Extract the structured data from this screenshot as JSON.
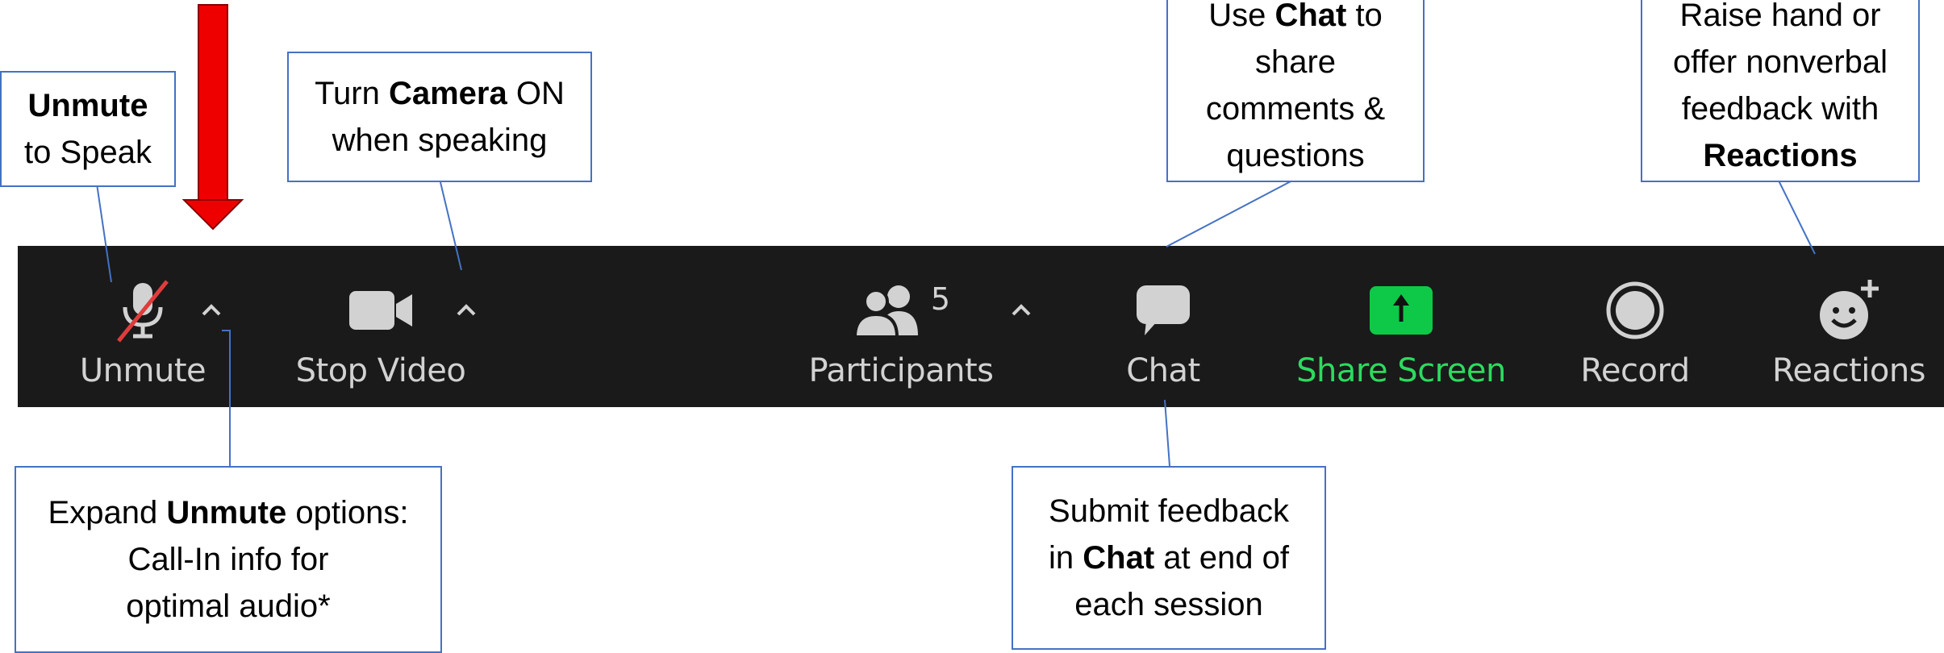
{
  "toolbar": {
    "unmute_label": "Unmute",
    "stop_video_label": "Stop Video",
    "participants_label": "Participants",
    "participants_count": "5",
    "chat_label": "Chat",
    "share_screen_label": "Share Screen",
    "record_label": "Record",
    "reactions_label": "Reactions"
  },
  "callouts": {
    "unmute": {
      "bold": "Unmute",
      "rest": "to Speak"
    },
    "camera": {
      "pre": "Turn ",
      "bold": "Camera",
      "post": " ON",
      "line2": "when speaking"
    },
    "chat_top": {
      "pre": "Use ",
      "bold": "Chat",
      "post": " to",
      "line2": "share",
      "line3": "comments &",
      "line4": "questions"
    },
    "reactions": {
      "line1": "Raise hand or",
      "line2": "offer nonverbal",
      "line3": "feedback with",
      "bold": "Reactions"
    },
    "expand": {
      "pre": "Expand ",
      "bold": "Unmute",
      "post": " options:",
      "line2": "Call-In info for",
      "line3": "optimal audio*"
    },
    "chat_bottom": {
      "line1": "Submit feedback",
      "pre": "in ",
      "bold": "Chat",
      "post": " at end of",
      "line3": "each session"
    }
  },
  "colors": {
    "toolbar_bg": "#1a1a1a",
    "icon_gray": "#d2d2d2",
    "share_green": "#0ec947",
    "mute_slash": "#e03c3c",
    "arrow_red": "#ee0000",
    "callout_border": "#4472c4"
  }
}
